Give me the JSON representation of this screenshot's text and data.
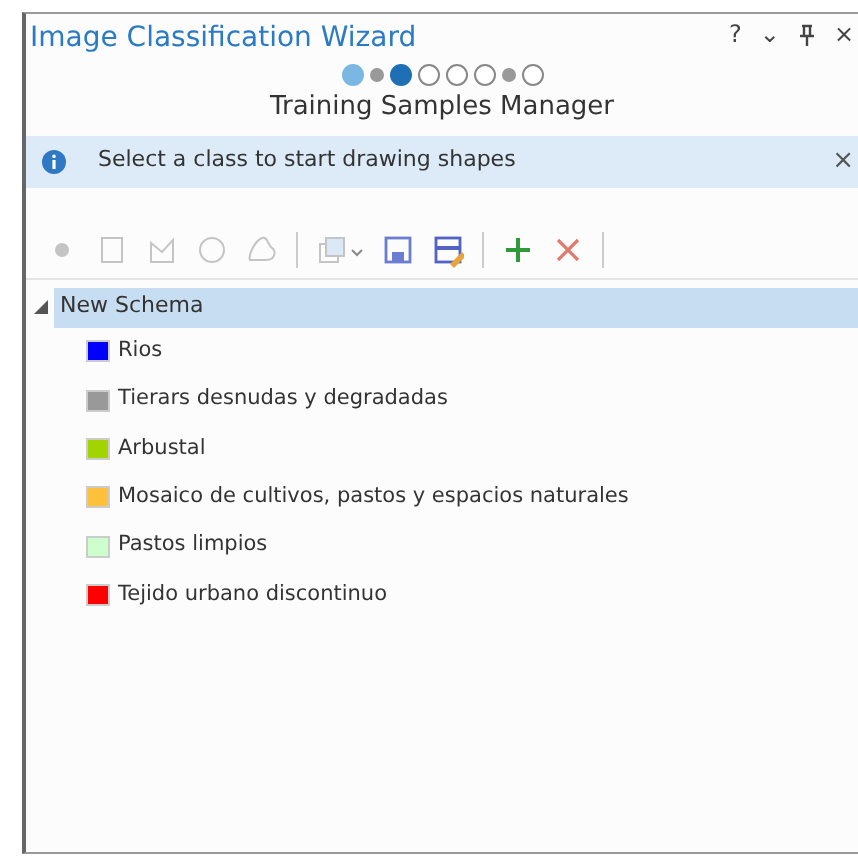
{
  "window": {
    "title": "Image Classification Wizard",
    "buttons": [
      "?",
      "⌄",
      "×"
    ]
  },
  "steps": [
    {
      "selected": false,
      "visited": true,
      "disabled": false
    },
    {
      "selected": false,
      "visited": false,
      "disabled": true
    },
    {
      "selected": true,
      "visited": false,
      "disabled": false
    },
    {
      "selected": false,
      "visited": false,
      "disabled": false
    },
    {
      "selected": false,
      "visited": false,
      "disabled": false
    },
    {
      "selected": false,
      "visited": false,
      "disabled": false
    },
    {
      "selected": false,
      "visited": false,
      "disabled": true
    },
    {
      "selected": false,
      "visited": false,
      "disabled": false
    }
  ],
  "subtitle": "Training Samples Manager",
  "info_bar": {
    "message": "Select a class to start drawing shapes",
    "close": "×"
  },
  "toolbar": [
    {
      "kind": "point",
      "disabled": true
    },
    {
      "kind": "rectangle",
      "disabled": true
    },
    {
      "kind": "polygon",
      "disabled": true
    },
    {
      "kind": "circle",
      "disabled": true
    },
    {
      "kind": "freehand",
      "disabled": true
    },
    {
      "kind": "separator"
    },
    {
      "kind": "select",
      "disabled": true
    },
    {
      "kind": "save",
      "disabled": false
    },
    {
      "kind": "save-as",
      "disabled": false
    },
    {
      "kind": "separator"
    },
    {
      "kind": "add",
      "disabled": false
    },
    {
      "kind": "remove",
      "disabled": false
    },
    {
      "kind": "separator"
    }
  ],
  "tree": {
    "label": "New Schema",
    "expanded": true,
    "selected": true,
    "children": [
      {
        "label": "Rios",
        "color": "#0000ff"
      },
      {
        "label": "Tierars desnudas y degradadas",
        "color": "#999999"
      },
      {
        "label": "Arbustal",
        "color": "#a2d400"
      },
      {
        "label": "Mosaico de cultivos, pastos y espacios naturales",
        "color": "#ffc13b"
      },
      {
        "label": "Pastos limpios",
        "color": "#ccffcc"
      },
      {
        "label": "Tejido urbano discontinuo",
        "color": "#ff0000"
      }
    ]
  }
}
